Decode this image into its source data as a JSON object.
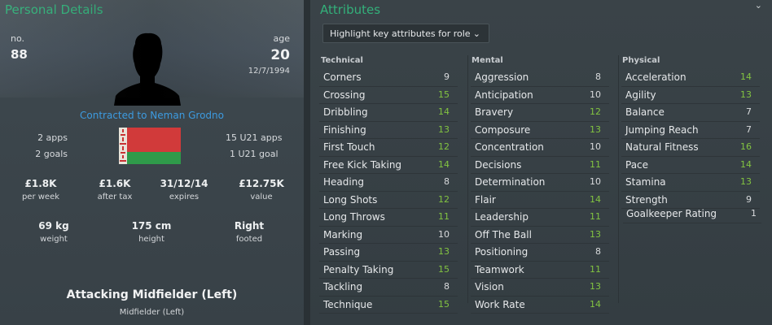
{
  "left": {
    "title": "Personal Details",
    "number_label": "no.",
    "number": "88",
    "age_label": "age",
    "age": "20",
    "dob": "12/7/1994",
    "contract": "Contracted to Neman Grodno",
    "apps": "2 apps",
    "goals": "2 goals",
    "u21_apps": "15 U21 apps",
    "u21_goals": "1 U21 goal",
    "wage": "£1.8K",
    "wage_label": "per week",
    "after_tax": "£1.6K",
    "after_tax_label": "after tax",
    "expires": "31/12/14",
    "expires_label": "expires",
    "value": "£12.75K",
    "value_label": "value",
    "weight": "69 kg",
    "weight_label": "weight",
    "height": "175 cm",
    "height_label": "height",
    "footed": "Right",
    "footed_label": "footed",
    "position_main": "Attacking Midfielder (Left)",
    "position_sub": "Midfielder (Left)",
    "flag_colors": {
      "red": "#d13a3a",
      "green": "#2f9a4a",
      "ornament": "#e8e4da"
    }
  },
  "right": {
    "title": "Attributes",
    "highlight_button": "Highlight key attributes for role",
    "collapse_icon": "chevron-down-icon",
    "technical_header": "Technical",
    "mental_header": "Mental",
    "physical_header": "Physical",
    "technical": [
      {
        "name": "Corners",
        "value": "9"
      },
      {
        "name": "Crossing",
        "value": "15"
      },
      {
        "name": "Dribbling",
        "value": "14"
      },
      {
        "name": "Finishing",
        "value": "13"
      },
      {
        "name": "First Touch",
        "value": "12"
      },
      {
        "name": "Free Kick Taking",
        "value": "14"
      },
      {
        "name": "Heading",
        "value": "8"
      },
      {
        "name": "Long Shots",
        "value": "12"
      },
      {
        "name": "Long Throws",
        "value": "11"
      },
      {
        "name": "Marking",
        "value": "10"
      },
      {
        "name": "Passing",
        "value": "13"
      },
      {
        "name": "Penalty Taking",
        "value": "15"
      },
      {
        "name": "Tackling",
        "value": "8"
      },
      {
        "name": "Technique",
        "value": "15"
      }
    ],
    "mental": [
      {
        "name": "Aggression",
        "value": "8"
      },
      {
        "name": "Anticipation",
        "value": "10"
      },
      {
        "name": "Bravery",
        "value": "12"
      },
      {
        "name": "Composure",
        "value": "13"
      },
      {
        "name": "Concentration",
        "value": "10"
      },
      {
        "name": "Decisions",
        "value": "11"
      },
      {
        "name": "Determination",
        "value": "10"
      },
      {
        "name": "Flair",
        "value": "14"
      },
      {
        "name": "Leadership",
        "value": "11"
      },
      {
        "name": "Off The Ball",
        "value": "13"
      },
      {
        "name": "Positioning",
        "value": "8"
      },
      {
        "name": "Teamwork",
        "value": "11"
      },
      {
        "name": "Vision",
        "value": "13"
      },
      {
        "name": "Work Rate",
        "value": "14"
      }
    ],
    "physical": [
      {
        "name": "Acceleration",
        "value": "14"
      },
      {
        "name": "Agility",
        "value": "13"
      },
      {
        "name": "Balance",
        "value": "7"
      },
      {
        "name": "Jumping Reach",
        "value": "7"
      },
      {
        "name": "Natural Fitness",
        "value": "16"
      },
      {
        "name": "Pace",
        "value": "14"
      },
      {
        "name": "Stamina",
        "value": "13"
      },
      {
        "name": "Strength",
        "value": "9"
      }
    ],
    "goalkeeper_rating_label": "Goalkeeper Rating",
    "goalkeeper_rating": "1"
  }
}
